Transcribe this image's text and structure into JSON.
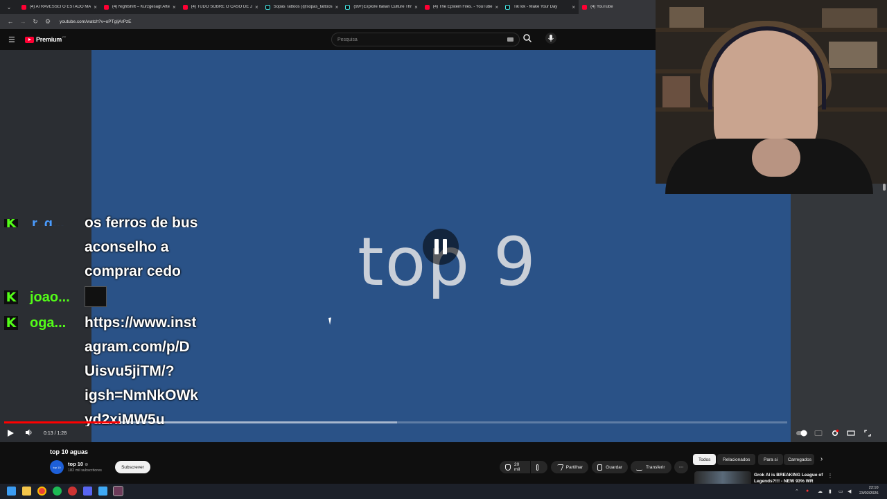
{
  "browser": {
    "tabs": [
      {
        "label": "(4) ATRAVESSEI O ESTADO MAIS",
        "favicon": "youtube"
      },
      {
        "label": "(4) Nightshift – Kurzgesagt Afte",
        "favicon": "youtube"
      },
      {
        "label": "(4) TUDO SOBRE O CASO DE JE",
        "favicon": "youtube"
      },
      {
        "label": "Sopas Tattoos (@sopas_tattoos",
        "favicon": "tiktok"
      },
      {
        "label": "(99+)Explore Italian Culture Thr",
        "favicon": "tiktok"
      },
      {
        "label": "(4) The Epstein Files. - YouTube",
        "favicon": "youtube"
      },
      {
        "label": "TikTok - Make Your Day",
        "favicon": "tiktok"
      },
      {
        "label": "(4) YouTube",
        "favicon": "youtube"
      }
    ],
    "tab_close_glyph": "×",
    "url": "youtube.com/watch?v=oPTgljArPzE"
  },
  "youtube": {
    "logo_text": "Premium",
    "logo_superscript": "PT",
    "search_placeholder": "Pesquisa"
  },
  "video": {
    "overlay_text": "top 9",
    "time_display": "0:13 / 1:28",
    "progress_fraction": 0.1477,
    "state": "paused-indicator",
    "accent_color": "#ff0000",
    "background_color": "#2a5287"
  },
  "chat": {
    "messages": [
      {
        "user": "r..g...",
        "text_lines": [
          "os ferros de bus",
          "aconselho a",
          "comprar cedo"
        ],
        "user_color": "#4a9cff"
      },
      {
        "user": "joao...",
        "text_lines": [],
        "emote": true,
        "user_color": "#53fc18"
      },
      {
        "user": "oga...",
        "text_lines": [
          "https://www.inst",
          "agram.com/p/D",
          "Uisvu5jiTM/?",
          "igsh=NmNkOWk",
          "yd2xiMW5u"
        ],
        "user_color": "#53fc18"
      }
    ],
    "badge_letter": "K"
  },
  "below_video": {
    "title": "top 10 aguas",
    "channel_name": "top 10",
    "channel_avatar_text": "top 10",
    "verified_glyph": "⊘",
    "subscribers": "182 mil subscritores",
    "subscribe_label": "Subscrever",
    "likes_label": "20 mil",
    "share_label": "Partilhar",
    "save_label": "Guardar",
    "download_label": "Transferir",
    "more_glyph": "⋯"
  },
  "sidebar_chips": [
    "Todos",
    "Relacionados",
    "Para si",
    "Carregados"
  ],
  "recommendation": {
    "title": "Grok AI is BREAKING League of Legends?!!! - NEW 93% WR"
  },
  "taskbar": {
    "time": "22:10",
    "date": "23/02/2026"
  }
}
